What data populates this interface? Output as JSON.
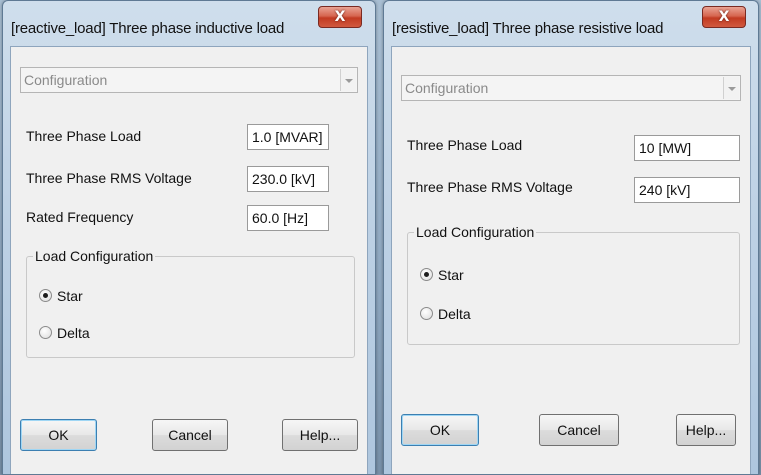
{
  "left_dialog": {
    "title": "[reactive_load] Three phase inductive load",
    "close_glyph": "X",
    "config_combo": "Configuration",
    "fields": [
      {
        "label": "Three Phase Load",
        "value": "1.0 [MVAR]"
      },
      {
        "label": "Three Phase RMS Voltage",
        "value": "230.0 [kV]"
      },
      {
        "label": "Rated Frequency",
        "value": "60.0 [Hz]"
      }
    ],
    "group_title": "Load Configuration",
    "options": [
      {
        "label": "Star",
        "checked": true
      },
      {
        "label": "Delta",
        "checked": false
      }
    ],
    "buttons": {
      "ok": "OK",
      "cancel": "Cancel",
      "help": "Help..."
    }
  },
  "right_dialog": {
    "title": "[resistive_load] Three phase resistive load",
    "close_glyph": "X",
    "config_combo": "Configuration",
    "fields": [
      {
        "label": "Three Phase Load",
        "value": "10 [MW]"
      },
      {
        "label": "Three Phase RMS Voltage",
        "value": "240 [kV]"
      }
    ],
    "group_title": "Load Configuration",
    "options": [
      {
        "label": "Star",
        "checked": true
      },
      {
        "label": "Delta",
        "checked": false
      }
    ],
    "buttons": {
      "ok": "OK",
      "cancel": "Cancel",
      "help": "Help..."
    }
  },
  "icons": {
    "close": "close-icon",
    "dropdown": "chevron-down-icon",
    "radio": "radio-button-icon"
  },
  "colors": {
    "close_button": "#c7432a",
    "dialog_frame": "#bcd0e4",
    "client_bg": "#f0f0f0"
  }
}
